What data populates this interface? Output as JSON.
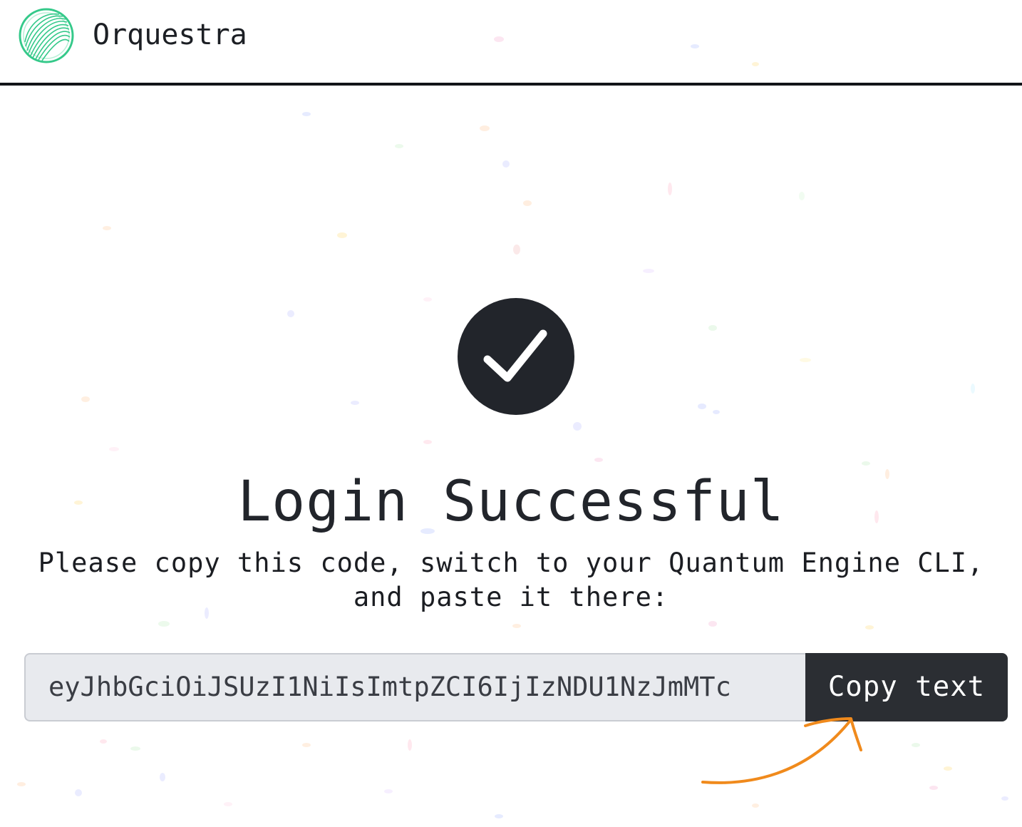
{
  "header": {
    "brand_name": "Orquestra",
    "logo_icon": "orquestra-logo"
  },
  "status": {
    "icon": "check-circle-icon",
    "title": "Login Successful",
    "instructions": "Please copy this code, switch to your Quantum Engine CLI, and paste it there:"
  },
  "code": {
    "value": "eyJhbGciOiJSUzI1NiIsImtpZCI6IjIzNDU1NzJmMTc",
    "copy_label": "Copy text"
  },
  "colors": {
    "accent_green": "#35c98a",
    "dark": "#22252b",
    "annotation_arrow": "#f08a1c"
  }
}
